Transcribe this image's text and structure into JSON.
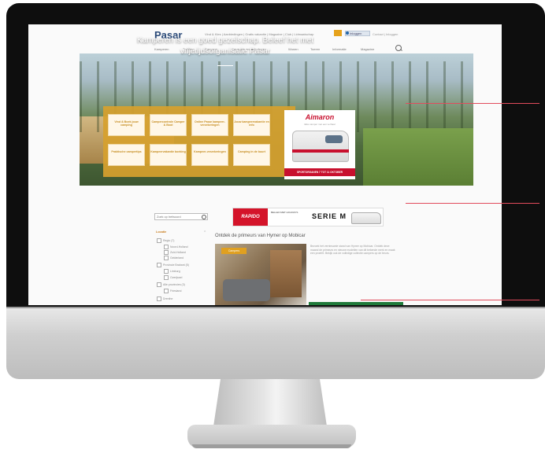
{
  "site": {
    "logo": "Pasar",
    "topbar_links": "Vind & Kies  |  Aanbiedingen  |  Gratis vakantie  |  Magazine  |  Club  |  Lidmaatschap",
    "login_label": "Inloggen",
    "topbar_extra": "Contact  |  Inloggen"
  },
  "nav": {
    "items": [
      "Kamperen",
      "Trekken",
      "Campers",
      "Caravans en toebehoren",
      "Wonen",
      "Toeren",
      "Informatie",
      "Magazine"
    ]
  },
  "hero": {
    "title": "Kamperen is een goed gezelschap. Beleef het met vrijetijdsorganisatie Pasar",
    "tiles": [
      "Vind & Boek jouw camping",
      "Campercontrole Camper & Boot",
      "Online Pasar kampeer-verzekeringen",
      "Jouw kampeervakantie en info",
      "Praktische campertips",
      "Kampeervakantie boeking",
      "Kampeer-verzekeringen",
      "Camping in de buurt"
    ],
    "promo": {
      "brand": "Aimaron",
      "tagline": "Elke camper met een verhaal",
      "footer": "SPORTORGANEN 7 TOT 11 OKTOBER"
    }
  },
  "sidebar": {
    "search_placeholder": "Zoek op trefwoord",
    "filter_heading": "Locatie",
    "filters": [
      "Regio (7)",
      "Noord-Holland",
      "Zuid-Holland",
      "Gelderland",
      "Provincie Brabant (5)",
      "Limburg",
      "Overijssel",
      "Alle provincies (3)",
      "Friesland",
      "Drenthe"
    ]
  },
  "ad": {
    "brand": "RAPIDO",
    "sub": "BELLEN MET HOLIDAYS",
    "serie": "SERIE M"
  },
  "article": {
    "title": "Ontdek de primeurs van Hymer op Mobicar",
    "tag": "Campers",
    "text": "Bezoek het vernieuwde stand van Hymer op Mobicar. Ontdek deze maand de primeurs en nieuwe modellen van dit bekende merk en maak een proefrit. Bekijk ook de volledige collectie campers op de beurs."
  },
  "colors": {
    "accent_orange": "#d6a02e",
    "brand_blue": "#2b4a78",
    "callout_red": "#e14b5c",
    "bezel": "#0e0e0e"
  }
}
